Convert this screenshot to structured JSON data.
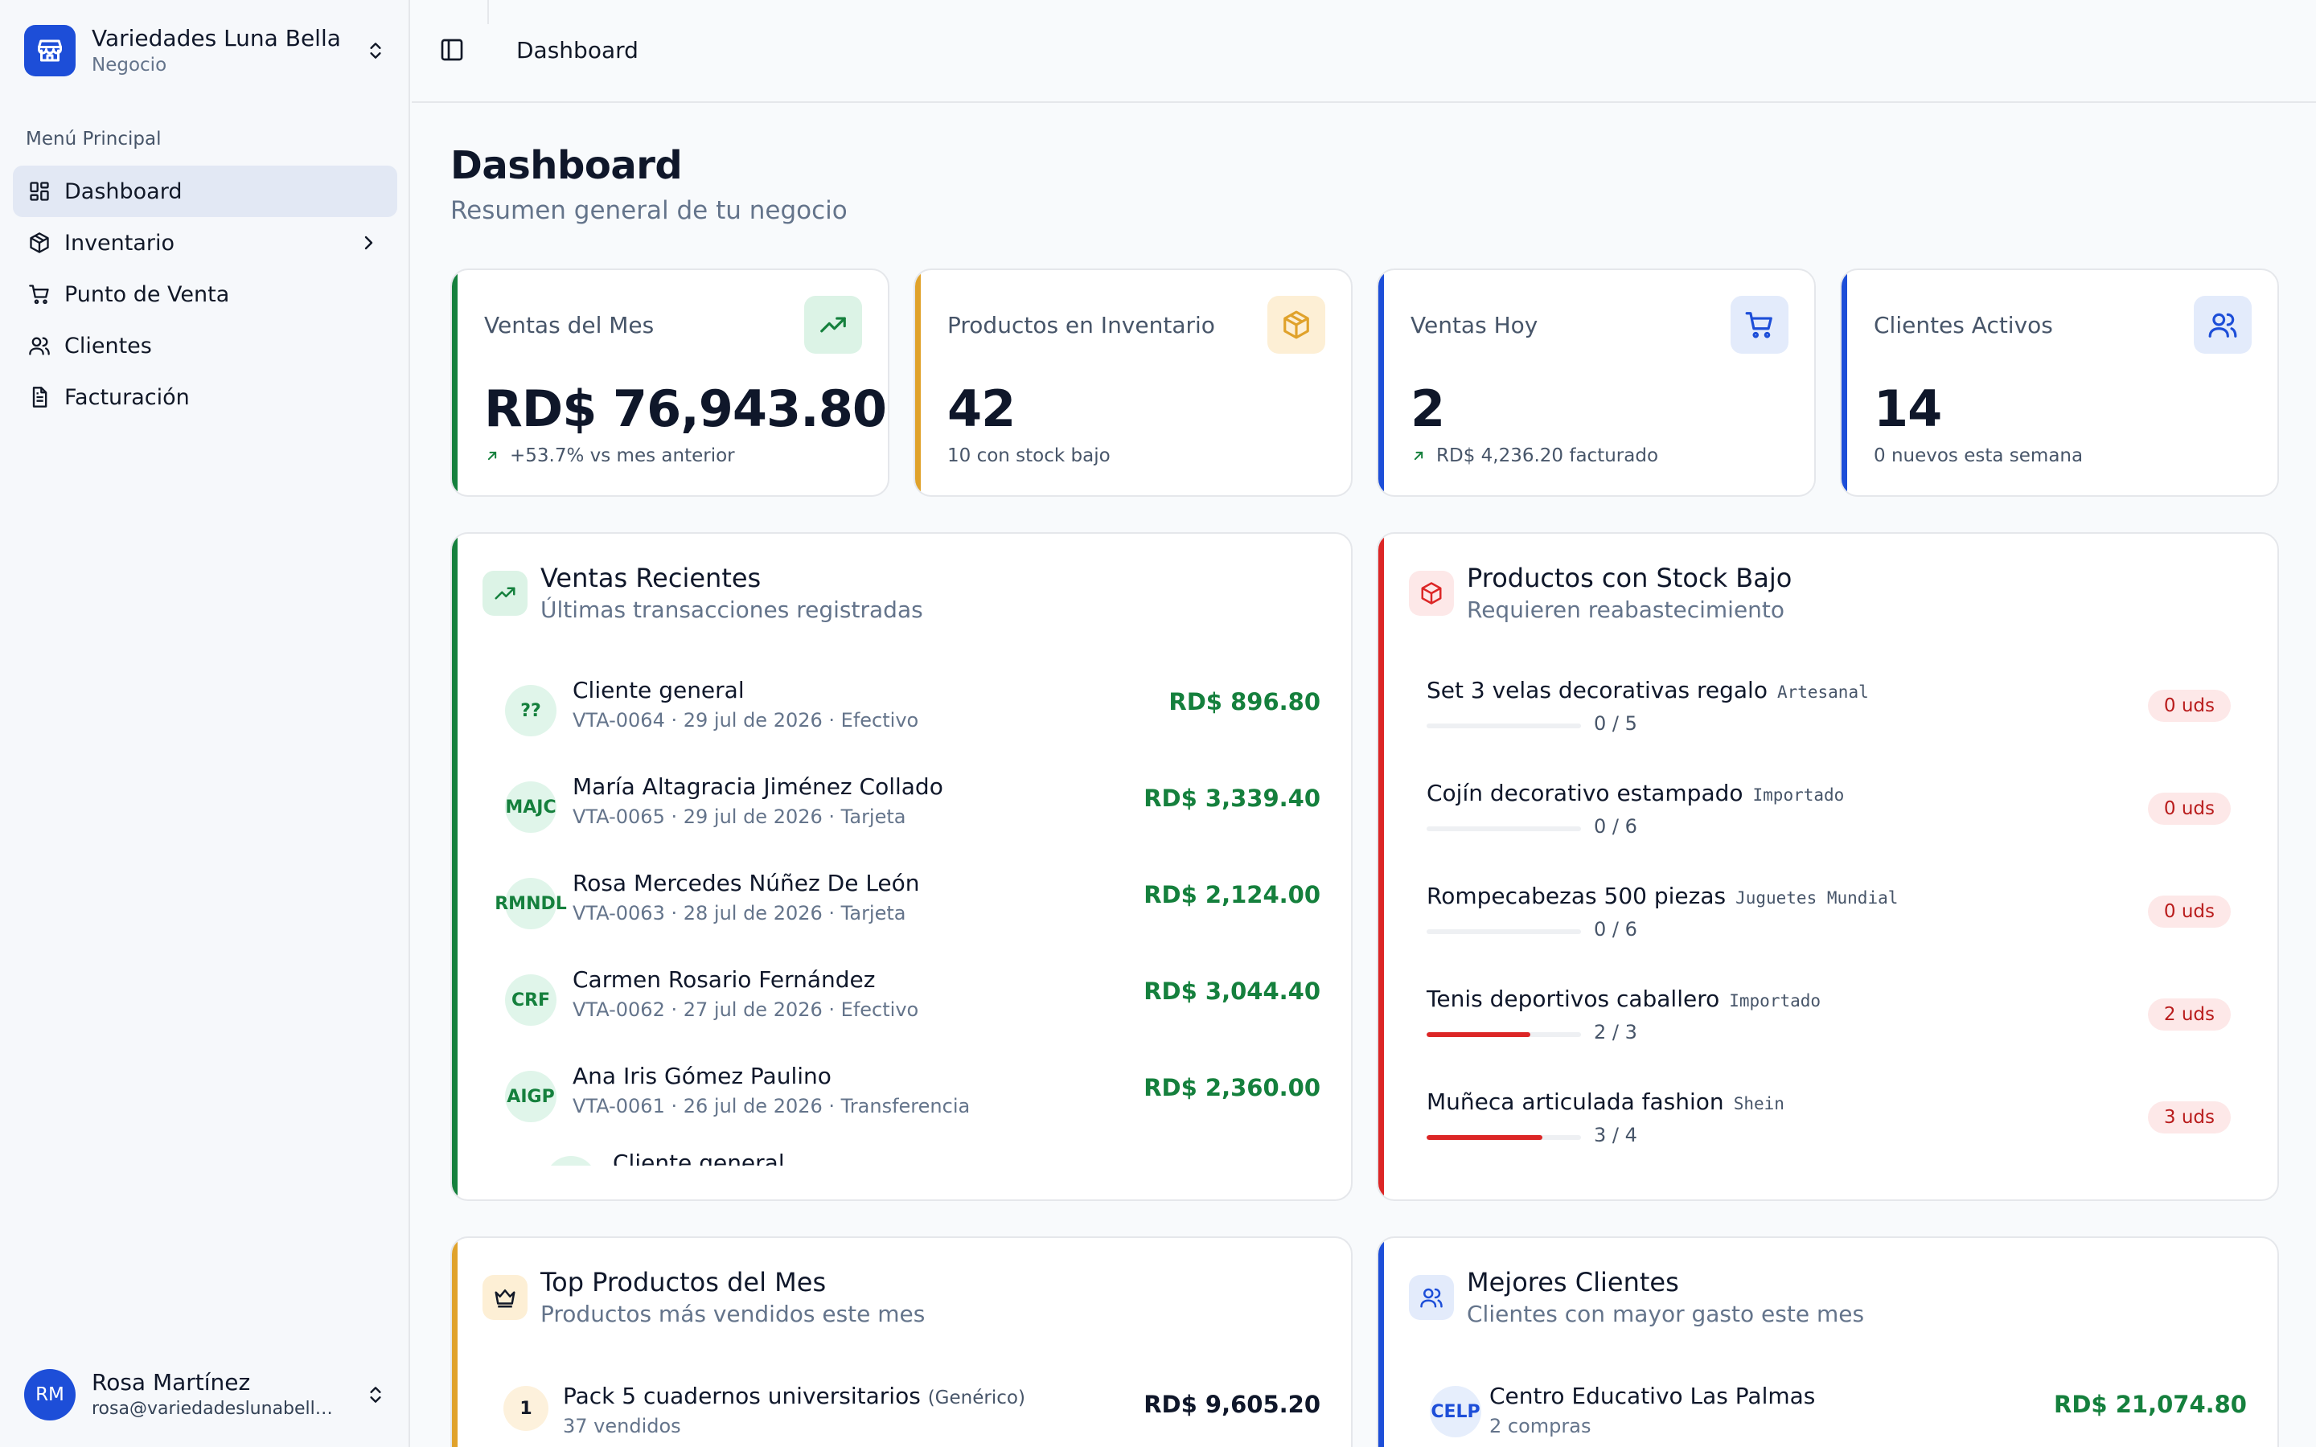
{
  "sidebar": {
    "brand_name": "Variedades Luna Bella",
    "brand_sub": "Negocio",
    "menu_title": "Menú Principal",
    "items": [
      {
        "label": "Dashboard",
        "icon": "dashboard-icon",
        "active": true
      },
      {
        "label": "Inventario",
        "icon": "package-icon"
      },
      {
        "label": "Punto de Venta",
        "icon": "cart-icon"
      },
      {
        "label": "Clientes",
        "icon": "users-icon"
      },
      {
        "label": "Facturación",
        "icon": "file-icon"
      }
    ],
    "user": {
      "initials": "RM",
      "name": "Rosa Martínez",
      "email": "rosa@variedadeslunabella...."
    }
  },
  "header": {
    "breadcrumb": "Dashboard"
  },
  "page": {
    "title": "Dashboard",
    "subtitle": "Resumen general de tu negocio"
  },
  "stats": [
    {
      "label": "Ventas del Mes",
      "value": "RD$ 76,943.80",
      "foot": "+53.7% vs mes anterior",
      "accent": "#15803d",
      "icon": "trending-up-icon"
    },
    {
      "label": "Productos en Inventario",
      "value": "42",
      "foot": "10 con stock bajo",
      "accent": "#e0a22b",
      "icon": "box-icon"
    },
    {
      "label": "Ventas Hoy",
      "value": "2",
      "foot": "RD$ 4,236.20 facturado",
      "accent": "#1d4ed8",
      "icon": "cart-icon"
    },
    {
      "label": "Clientes Activos",
      "value": "14",
      "foot": "0 nuevos esta semana",
      "accent": "#1d4ed8",
      "icon": "users-icon"
    }
  ],
  "recent_sales": {
    "title": "Ventas Recientes",
    "subtitle": "Últimas transacciones registradas",
    "rows": [
      {
        "initials": "??",
        "name": "Cliente general",
        "meta": "VTA-0064  ·  29 jul de 2026  ·  Efectivo",
        "amount": "RD$ 896.80"
      },
      {
        "initials": "MAJC",
        "name": "María Altagracia Jiménez Collado",
        "meta": "VTA-0065  ·  29 jul de 2026  ·  Tarjeta",
        "amount": "RD$ 3,339.40"
      },
      {
        "initials": "RMNDL",
        "name": "Rosa Mercedes Núñez De León",
        "meta": "VTA-0063  ·  28 jul de 2026  ·  Tarjeta",
        "amount": "RD$ 2,124.00"
      },
      {
        "initials": "CRF",
        "name": "Carmen Rosario Fernández",
        "meta": "VTA-0062  ·  27 jul de 2026  ·  Efectivo",
        "amount": "RD$ 3,044.40"
      },
      {
        "initials": "AIGP",
        "name": "Ana Iris Gómez Paulino",
        "meta": "VTA-0061  ·  26 jul de 2026  ·  Transferencia",
        "amount": "RD$ 2,360.00"
      },
      {
        "initials": "",
        "name": "Cliente general",
        "meta": "",
        "amount": ""
      }
    ]
  },
  "low_stock": {
    "title": "Productos con Stock Bajo",
    "subtitle": "Requieren reabastecimiento",
    "rows": [
      {
        "name": "Set 3 velas decorativas regalo",
        "brand": "Artesanal",
        "count": "0 / 5",
        "level": 0,
        "badge": "0 uds"
      },
      {
        "name": "Cojín decorativo estampado",
        "brand": "Importado",
        "count": "0 / 6",
        "level": 0,
        "badge": "0 uds"
      },
      {
        "name": "Rompecabezas 500 piezas",
        "brand": "Juguetes Mundial",
        "count": "0 / 6",
        "level": 0,
        "badge": "0 uds"
      },
      {
        "name": "Tenis deportivos caballero",
        "brand": "Importado",
        "count": "2 / 3",
        "level": 0.67,
        "badge": "2 uds"
      },
      {
        "name": "Muñeca articulada fashion",
        "brand": "Shein",
        "count": "3 / 4",
        "level": 0.75,
        "badge": "3 uds"
      }
    ]
  },
  "top_products": {
    "title": "Top Productos del Mes",
    "subtitle": "Productos más vendidos este mes",
    "rows": [
      {
        "rank": "1",
        "name": "Pack 5 cuadernos universitarios",
        "brand": "(Genérico)",
        "sub": "37 vendidos",
        "amount": "RD$ 9,605.20"
      }
    ]
  },
  "best_clients": {
    "title": "Mejores Clientes",
    "subtitle": "Clientes con mayor gasto este mes",
    "rows": [
      {
        "initials": "CELP",
        "name": "Centro Educativo Las Palmas",
        "sub": "2 compras",
        "amount": "RD$ 21,074.80"
      }
    ]
  },
  "colors": {
    "green": "#15803d",
    "amber": "#e0a22b",
    "blue": "#1d4ed8",
    "red": "#dc2626"
  }
}
